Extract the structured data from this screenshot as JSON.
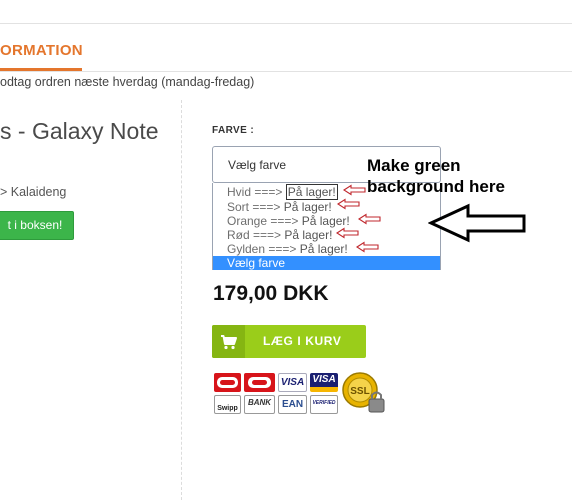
{
  "tabs": {
    "active": "ORMATION"
  },
  "delivery_text": "odtag ordren næste hverdag (mandag-fredag)",
  "product": {
    "title": "s - Galaxy Note",
    "breadcrumb": "> Kalaideng",
    "stock_button": "t i boksen!"
  },
  "color_select": {
    "label": "FARVE :",
    "value": "Vælg farve",
    "options": [
      {
        "name": "Hvid",
        "sep": " ===> ",
        "status": "På lager!"
      },
      {
        "name": "Sort",
        "sep": " ===> ",
        "status": "På lager!"
      },
      {
        "name": "Orange",
        "sep": " ===> ",
        "status": "På lager!"
      },
      {
        "name": "Rød",
        "sep": " ===> ",
        "status": "På lager!"
      },
      {
        "name": "Gylden",
        "sep": " ===> ",
        "status": "På lager!"
      },
      {
        "name": "Vælg farve",
        "sep": "",
        "status": ""
      }
    ]
  },
  "annotation": {
    "line1": "Make green",
    "line2": "background here"
  },
  "price": "179,00 DKK",
  "cart_button": "LÆG I KURV",
  "payment": {
    "visa": "VISA",
    "swipp": "Swipp",
    "bank": "BANK",
    "ean": "EAN",
    "verified": "VERIFIED",
    "ssl": "SSL"
  },
  "colors": {
    "accent": "#e4762d",
    "cart_green": "#9acd1a",
    "stock_green": "#3cb54a",
    "highlight": "#3390ff"
  }
}
